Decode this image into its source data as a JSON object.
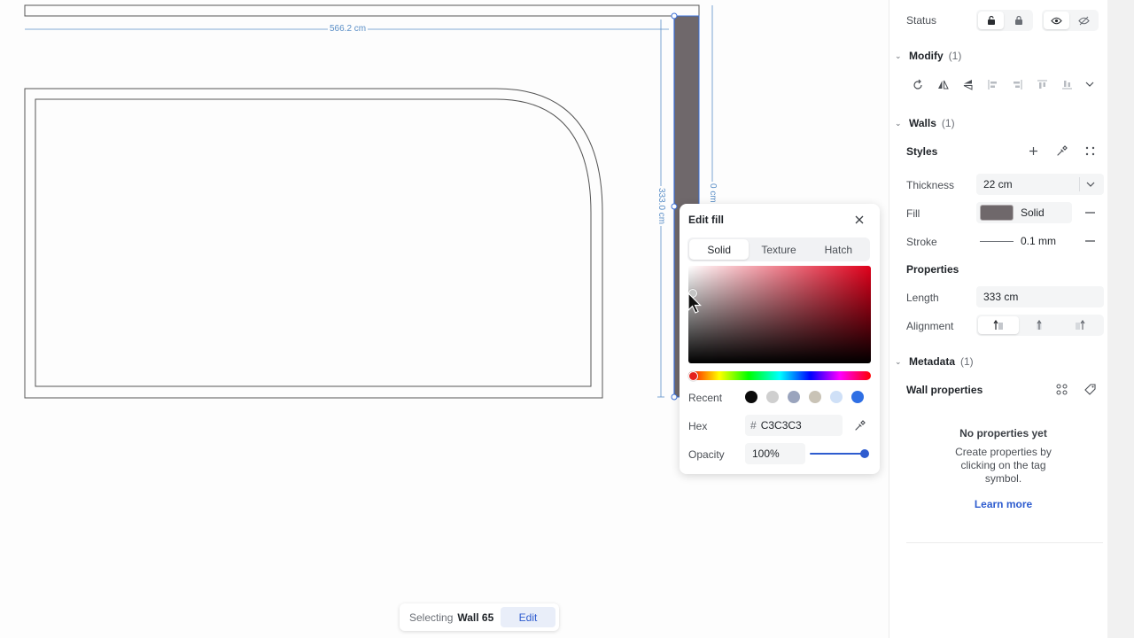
{
  "canvas": {
    "dim_width": "566.2 cm",
    "dim_height": "333.0 cm",
    "dim_right_partial": "0 cm"
  },
  "selection_bar": {
    "label": "Selecting",
    "value": "Wall 65",
    "edit_label": "Edit"
  },
  "edit_fill": {
    "title": "Edit fill",
    "tabs": [
      {
        "label": "Solid",
        "active": true
      },
      {
        "label": "Texture",
        "active": false
      },
      {
        "label": "Hatch",
        "active": false
      }
    ],
    "recent_label": "Recent",
    "recent_colors": [
      "#0a0a0a",
      "#cfcfcf",
      "#9aa4bd",
      "#c9c3b6",
      "#cfe0f7",
      "#2f6fe4"
    ],
    "hex_label": "Hex",
    "hex_hash": "#",
    "hex_value": "C3C3C3",
    "opacity_label": "Opacity",
    "opacity_value": "100%",
    "opacity_fraction": 1.0,
    "hue_color": "#e5201b"
  },
  "panel": {
    "status_label": "Status",
    "modify": {
      "name": "Modify",
      "count": "(1)"
    },
    "walls": {
      "name": "Walls",
      "count": "(1)"
    },
    "styles_label": "Styles",
    "thickness_label": "Thickness",
    "thickness_value": "22 cm",
    "fill_label": "Fill",
    "fill_value": "Solid",
    "fill_color": "#6f686b",
    "stroke_label": "Stroke",
    "stroke_value": "0.1 mm",
    "properties_label": "Properties",
    "length_label": "Length",
    "length_value": "333 cm",
    "alignment_label": "Alignment",
    "metadata": {
      "name": "Metadata",
      "count": "(1)"
    },
    "wall_properties_label": "Wall properties",
    "empty_title": "No properties yet",
    "empty_desc": "Create properties by clicking on the tag symbol.",
    "learn_more": "Learn more"
  },
  "colors": {
    "accent": "#2e5ccf",
    "dimension": "#5b8fc7",
    "wall_fill": "#6f686b"
  }
}
